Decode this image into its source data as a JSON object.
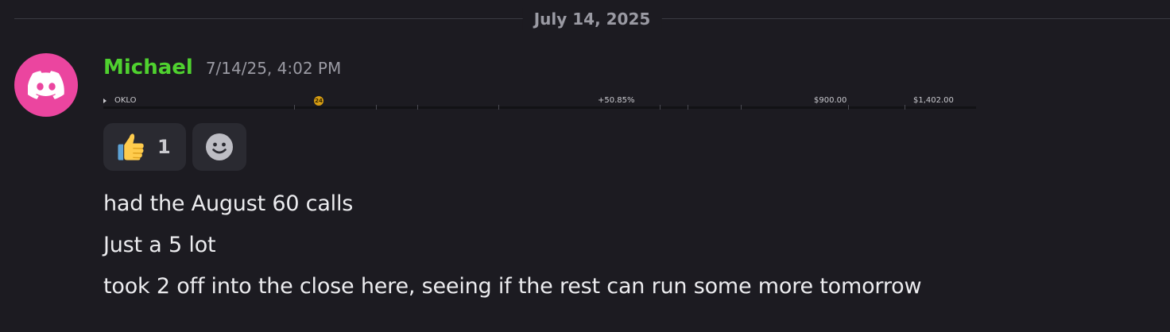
{
  "divider": {
    "date": "July 14, 2025"
  },
  "message": {
    "author": "Michael",
    "timestamp": "7/14/25, 4:02 PM",
    "ticker": {
      "symbol": "OKLO",
      "badge": "24",
      "change": "+50.85%",
      "value1": "$900.00",
      "value2": "$1,402.00"
    },
    "reactions": [
      {
        "emoji": "thumbs-up",
        "count": "1"
      }
    ],
    "lines": [
      "had the August 60 calls",
      "Just a 5 lot",
      "took 2 off into the close here, seeing if the rest can run some more tomorrow"
    ]
  },
  "colors": {
    "background": "#1c1b21",
    "username": "#4fd12f",
    "avatar": "#eb459f",
    "reaction_bg": "#2a2a31"
  },
  "icons": {
    "avatar": "discord-logo-icon",
    "reaction": "thumbs-up-icon",
    "add_reaction": "smiley-face-icon"
  }
}
